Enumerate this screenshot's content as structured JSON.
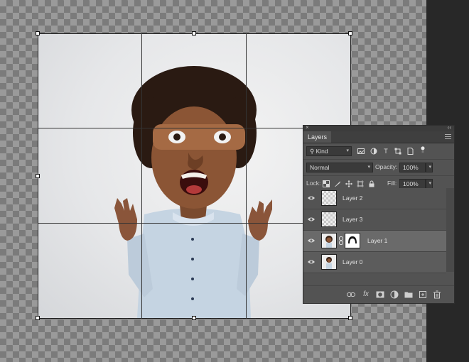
{
  "layers_panel": {
    "close_glyph": "×",
    "collapse_glyph": "‹‹",
    "tab_label": "Layers",
    "filter": {
      "kind_label": "Kind",
      "search_glyph": "⚲"
    },
    "blend_mode": "Normal",
    "opacity_label": "Opacity:",
    "opacity_value": "100%",
    "lock_label": "Lock:",
    "fill_label": "Fill:",
    "fill_value": "100%",
    "layers": [
      {
        "name": "Layer 2",
        "visible": true,
        "selected": false,
        "has_mask": false
      },
      {
        "name": "Layer 3",
        "visible": true,
        "selected": false,
        "has_mask": false
      },
      {
        "name": "Layer 1",
        "visible": true,
        "selected": true,
        "has_mask": true
      },
      {
        "name": "Layer 0",
        "visible": true,
        "selected": false,
        "has_mask": false
      }
    ],
    "bottom_icons": [
      "link-icon",
      "fx-icon",
      "add-mask-icon",
      "adjustment-icon",
      "new-group-icon",
      "new-layer-icon",
      "trash-icon"
    ],
    "fx_glyph": "fx"
  },
  "colors": {
    "panel_bg": "#535353",
    "selected_row": "#6a6a6a",
    "canvas_check_light": "#9a9a9a",
    "canvas_check_dark": "#7b7b7b"
  }
}
